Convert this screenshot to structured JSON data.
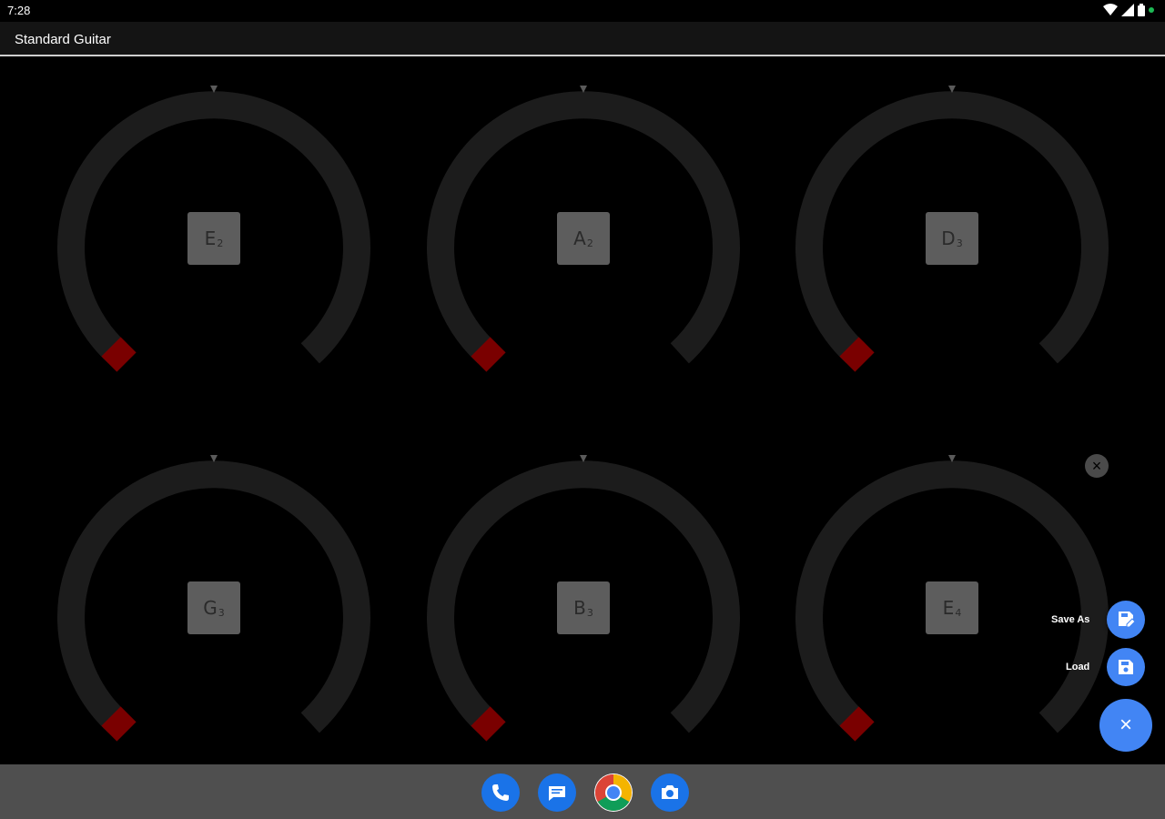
{
  "status_bar": {
    "time": "7:28",
    "icons": [
      "wifi-icon",
      "signal-icon",
      "battery-icon"
    ]
  },
  "app_bar": {
    "title": "Standard Guitar"
  },
  "tuners": [
    {
      "note": "E",
      "octave": "2"
    },
    {
      "note": "A",
      "octave": "2"
    },
    {
      "note": "D",
      "octave": "3"
    },
    {
      "note": "G",
      "octave": "3"
    },
    {
      "note": "B",
      "octave": "3"
    },
    {
      "note": "E",
      "octave": "4"
    }
  ],
  "fab_menu": {
    "save_as_label": "Save As",
    "load_label": "Load",
    "close_icon": "close-icon",
    "dismiss_icon": "close-icon"
  },
  "dock": {
    "apps": [
      "phone-icon",
      "messages-icon",
      "chrome-icon",
      "camera-icon"
    ]
  },
  "colors": {
    "accent": "#4285f4",
    "dial_track": "#1c1c1c",
    "needle_marker": "#7a0000",
    "note_box": "#5d5d5d"
  }
}
